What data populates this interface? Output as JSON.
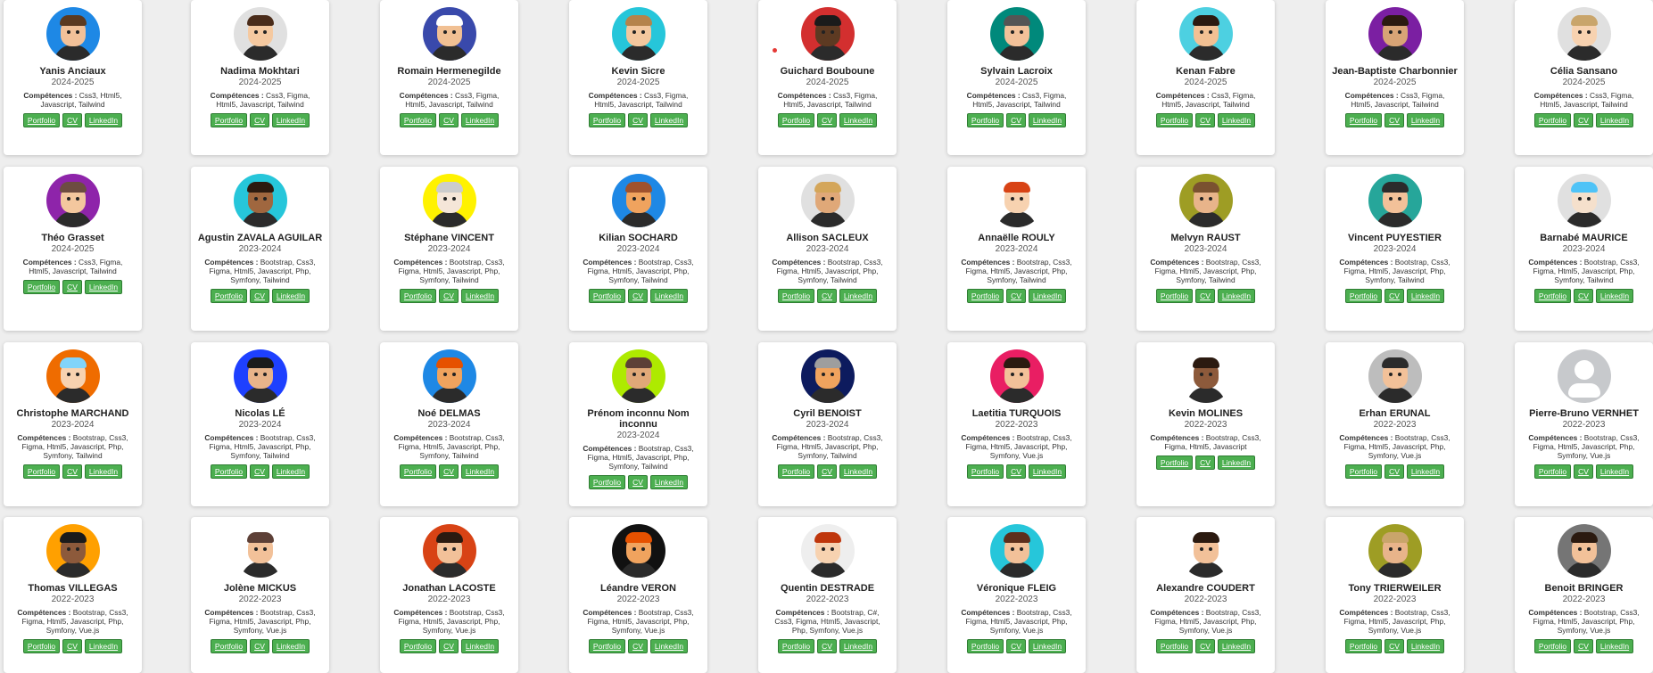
{
  "labels": {
    "skills_prefix": "Compétences :",
    "portfolio": "Portfolio",
    "cv": "CV",
    "linkedin": "LinkedIn"
  },
  "students": [
    {
      "name": "Yanis Anciaux",
      "year": "2024-2025",
      "skills": "Css3, Html5, Javascript, Tailwind",
      "bg": "#1e88e5",
      "skin": "#f2c199",
      "hair": "#5b3a21"
    },
    {
      "name": "Nadima Mokhtari",
      "year": "2024-2025",
      "skills": "Css3, Figma, Html5, Javascript, Tailwind",
      "bg": "#e0e0e0",
      "skin": "#f5c9a0",
      "hair": "#4a2c1a"
    },
    {
      "name": "Romain Hermenegilde",
      "year": "2024-2025",
      "skills": "Css3, Figma, Html5, Javascript, Tailwind",
      "bg": "#3949ab",
      "skin": "#f1c093",
      "hair": "#ffffff"
    },
    {
      "name": "Kevin Sicre",
      "year": "2024-2025",
      "skills": "Css3, Figma, Html5, Javascript, Tailwind",
      "bg": "#26c6da",
      "skin": "#f3c79e",
      "hair": "#b5834b"
    },
    {
      "name": "Guichard Bouboune",
      "year": "2024-2025",
      "skills": "Css3, Figma, Html5, Javascript, Tailwind",
      "bg": "#d32f2f",
      "skin": "#5d3a22",
      "hair": "#1b1b1b"
    },
    {
      "name": "Sylvain Lacroix",
      "year": "2024-2025",
      "skills": "Css3, Figma, Html5, Javascript, Tailwind",
      "bg": "#00897b",
      "skin": "#f2c199",
      "hair": "#555555"
    },
    {
      "name": "Kenan Fabre",
      "year": "2024-2025",
      "skills": "Css3, Figma, Html5, Javascript, Tailwind",
      "bg": "#4dd0e1",
      "skin": "#f1c093",
      "hair": "#2b1a10"
    },
    {
      "name": "Jean-Baptiste Charbonnier",
      "year": "2024-2025",
      "skills": "Css3, Figma, Html5, Javascript, Tailwind",
      "bg": "#7b1fa2",
      "skin": "#d8a476",
      "hair": "#2b1a10"
    },
    {
      "name": "Célia Sansano",
      "year": "2024-2025",
      "skills": "Css3, Figma, Html5, Javascript, Tailwind",
      "bg": "#e0e0e0",
      "skin": "#f7d2b0",
      "hair": "#c9a56b"
    },
    {
      "name": "Théo Grasset",
      "year": "2024-2025",
      "skills": "Css3, Figma, Html5, Javascript, Tailwind",
      "bg": "#8e24aa",
      "skin": "#f3c79e",
      "hair": "#6d4c41"
    },
    {
      "name": "Agustin ZAVALA AGUILAR",
      "year": "2023-2024",
      "skills": "Bootstrap, Css3, Figma, Html5, Javascript, Php, Symfony, Tailwind",
      "bg": "#26c6da",
      "skin": "#a0673f",
      "hair": "#2b1a10"
    },
    {
      "name": "Stéphane VINCENT",
      "year": "2023-2024",
      "skills": "Bootstrap, Css3, Figma, Html5, Javascript, Php, Symfony, Tailwind",
      "bg": "#fff200",
      "skin": "#f5e6d8",
      "hair": "#cccccc"
    },
    {
      "name": "Kilian SOCHARD",
      "year": "2023-2024",
      "skills": "Bootstrap, Css3, Figma, Html5, Javascript, Php, Symfony, Tailwind",
      "bg": "#1e88e5",
      "skin": "#f0a35e",
      "hair": "#a0522d"
    },
    {
      "name": "Allison SACLEUX",
      "year": "2023-2024",
      "skills": "Bootstrap, Css3, Figma, Html5, Javascript, Php, Symfony, Tailwind",
      "bg": "#e0e0e0",
      "skin": "#e0a878",
      "hair": "#d4a65a"
    },
    {
      "name": "Annaëlle ROULY",
      "year": "2023-2024",
      "skills": "Bootstrap, Css3, Figma, Html5, Javascript, Php, Symfony, Tailwind",
      "bg": "#ffffff",
      "skin": "#f7d2b0",
      "hair": "#d84315"
    },
    {
      "name": "Melvyn RAUST",
      "year": "2023-2024",
      "skills": "Bootstrap, Css3, Figma, Html5, Javascript, Php, Symfony, Tailwind",
      "bg": "#9e9d24",
      "skin": "#e8b48a",
      "hair": "#7a5230"
    },
    {
      "name": "Vincent PUYESTIER",
      "year": "2023-2024",
      "skills": "Bootstrap, Css3, Figma, Html5, Javascript, Php, Symfony, Tailwind",
      "bg": "#26a69a",
      "skin": "#f2c199",
      "hair": "#2b2b2b"
    },
    {
      "name": "Barnabé MAURICE",
      "year": "2023-2024",
      "skills": "Bootstrap, Css3, Figma, Html5, Javascript, Php, Symfony, Tailwind",
      "bg": "#e0e0e0",
      "skin": "#f5e0cc",
      "hair": "#4fc3f7"
    },
    {
      "name": "Christophe MARCHAND",
      "year": "2023-2024",
      "skills": "Bootstrap, Css3, Figma, Html5, Javascript, Php, Symfony, Tailwind",
      "bg": "#ef6c00",
      "skin": "#f7d2b0",
      "hair": "#81d4fa"
    },
    {
      "name": "Nicolas LÉ",
      "year": "2023-2024",
      "skills": "Bootstrap, Css3, Figma, Html5, Javascript, Php, Symfony, Tailwind",
      "bg": "#1e40ff",
      "skin": "#e8b48a",
      "hair": "#1b1b1b"
    },
    {
      "name": "Noé DELMAS",
      "year": "2023-2024",
      "skills": "Bootstrap, Css3, Figma, Html5, Javascript, Php, Symfony, Tailwind",
      "bg": "#1e88e5",
      "skin": "#f0a35e",
      "hair": "#e65100"
    },
    {
      "name": "Prénom inconnu Nom inconnu",
      "year": "2023-2024",
      "skills": "Bootstrap, Css3, Figma, Html5, Javascript, Php, Symfony, Tailwind",
      "bg": "#aeea00",
      "skin": "#e0a878",
      "hair": "#5d4037"
    },
    {
      "name": "Cyril BENOIST",
      "year": "2023-2024",
      "skills": "Bootstrap, Css3, Figma, Html5, Javascript, Php, Symfony, Tailwind",
      "bg": "#0d1b5e",
      "skin": "#f0a35e",
      "hair": "#9e9e9e"
    },
    {
      "name": "Laetitia TURQUOIS",
      "year": "2022-2023",
      "skills": "Bootstrap, Css3, Figma, Html5, Javascript, Php, Symfony, Vue.js",
      "bg": "#e91e63",
      "skin": "#f2c199",
      "hair": "#2b1a10"
    },
    {
      "name": "Kevin MOLINES",
      "year": "2022-2023",
      "skills": "Bootstrap, Css3, Figma, Html5, Javascript",
      "bg": "#ffffff",
      "skin": "#8d5a3b",
      "hair": "#2b1a10"
    },
    {
      "name": "Erhan ERUNAL",
      "year": "2022-2023",
      "skills": "Bootstrap, Css3, Figma, Html5, Javascript, Php, Symfony, Vue.js",
      "bg": "#bdbdbd",
      "skin": "#f2c199",
      "hair": "#2b2b2b"
    },
    {
      "name": "Pierre-Bruno VERNHET",
      "year": "2022-2023",
      "skills": "Bootstrap, Css3, Figma, Html5, Javascript, Php, Symfony, Vue.js",
      "bg": "#c7c9cc",
      "skin": "#ffffff",
      "hair": "#ffffff",
      "unknown": true
    },
    {
      "name": "Thomas VILLEGAS",
      "year": "2022-2023",
      "skills": "Bootstrap, Css3, Figma, Html5, Javascript, Php, Symfony, Vue.js",
      "bg": "#ffa000",
      "skin": "#8d5a3b",
      "hair": "#1b1b1b"
    },
    {
      "name": "Jolène MICKUS",
      "year": "2022-2023",
      "skills": "Bootstrap, Css3, Figma, Html5, Javascript, Php, Symfony, Vue.js",
      "bg": "#ffffff",
      "skin": "#f2c199",
      "hair": "#5d4037"
    },
    {
      "name": "Jonathan LACOSTE",
      "year": "2022-2023",
      "skills": "Bootstrap, Css3, Figma, Html5, Javascript, Php, Symfony, Vue.js",
      "bg": "#d84315",
      "skin": "#f2c199",
      "hair": "#2b1a10"
    },
    {
      "name": "Léandre VERON",
      "year": "2022-2023",
      "skills": "Bootstrap, Css3, Figma, Html5, Javascript, Php, Symfony, Vue.js",
      "bg": "#111111",
      "skin": "#f0a35e",
      "hair": "#e65100"
    },
    {
      "name": "Quentin DESTRADE",
      "year": "2022-2023",
      "skills": "Bootstrap, C#, Css3, Figma, Html5, Javascript, Php, Symfony, Vue.js",
      "bg": "#eeeeee",
      "skin": "#f7d2b0",
      "hair": "#bf360c"
    },
    {
      "name": "Véronique FLEIG",
      "year": "2022-2023",
      "skills": "Bootstrap, Css3, Figma, Html5, Javascript, Php, Symfony, Vue.js",
      "bg": "#26c6da",
      "skin": "#f2c199",
      "hair": "#5d2f1c"
    },
    {
      "name": "Alexandre COUDERT",
      "year": "2022-2023",
      "skills": "Bootstrap, Css3, Figma, Html5, Javascript, Php, Symfony, Vue.js",
      "bg": "#ffffff",
      "skin": "#f2c199",
      "hair": "#2b1a10"
    },
    {
      "name": "Tony TRIERWEILER",
      "year": "2022-2023",
      "skills": "Bootstrap, Css3, Figma, Html5, Javascript, Php, Symfony, Vue.js",
      "bg": "#9e9d24",
      "skin": "#e8b48a",
      "hair": "#c9a56b"
    },
    {
      "name": "Benoit BRINGER",
      "year": "2022-2023",
      "skills": "Bootstrap, Css3, Figma, Html5, Javascript, Php, Symfony, Vue.js",
      "bg": "#757575",
      "skin": "#f2c199",
      "hair": "#2b1a10"
    }
  ]
}
